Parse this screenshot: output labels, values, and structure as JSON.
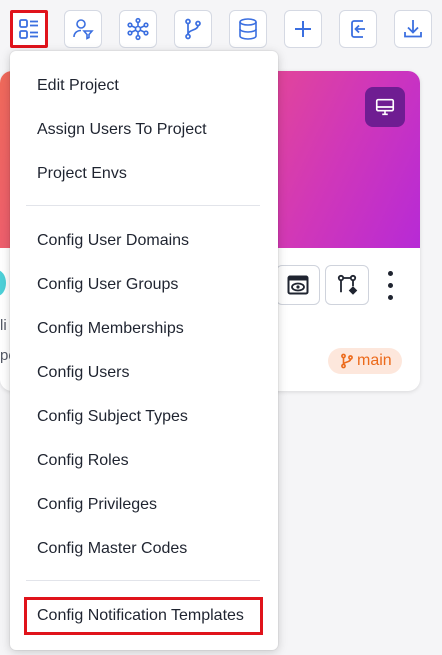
{
  "toolbar": {
    "buttons": [
      {
        "name": "list-view",
        "icon": "list-grid-icon",
        "active": true
      },
      {
        "name": "user-access",
        "icon": "user-filter-icon"
      },
      {
        "name": "network",
        "icon": "network-icon"
      },
      {
        "name": "branch",
        "icon": "git-branch-icon"
      },
      {
        "name": "database",
        "icon": "database-icon"
      },
      {
        "name": "add",
        "icon": "plus-icon"
      },
      {
        "name": "import",
        "icon": "import-icon"
      },
      {
        "name": "download",
        "icon": "download-icon"
      }
    ],
    "accent_color": "#3b6fe0",
    "active_border_color": "#e0131b"
  },
  "card": {
    "fragment_line1": "li",
    "fragment_line2": "pe",
    "branch_label": "main",
    "banner_icon": "desktop-icon",
    "actions": [
      "preview-icon",
      "git-diff-icon",
      "more-icon"
    ]
  },
  "menu": {
    "group1": [
      "Edit Project",
      "Assign Users To Project",
      "Project Envs"
    ],
    "group2": [
      "Config User Domains",
      "Config User Groups",
      "Config Memberships",
      "Config Users",
      "Config Subject Types",
      "Config Roles",
      "Config Privileges",
      "Config Master Codes"
    ],
    "group3": [
      "Config Notification Templates"
    ],
    "highlighted": "Config Notification Templates"
  }
}
